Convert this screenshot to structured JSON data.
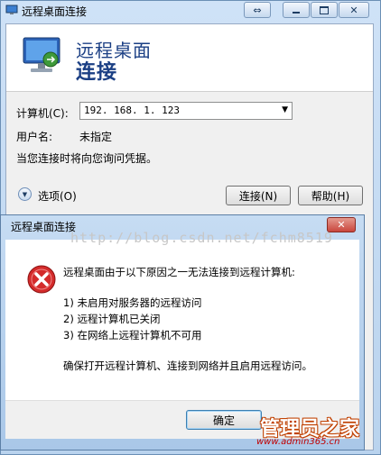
{
  "window": {
    "title": "远程桌面连接",
    "heading_line1": "远程桌面",
    "heading_line2": "连接",
    "computer_label": "计算机(C):",
    "computer_value": "192. 168. 1. 123",
    "username_label": "用户名:",
    "username_value": "未指定",
    "info_text": "当您连接时将向您询问凭据。",
    "options_label": "选项(O)",
    "connect_button": "连接(N)",
    "help_button": "帮助(H)"
  },
  "dialog": {
    "title": "远程桌面连接",
    "message": "远程桌面由于以下原因之一无法连接到远程计算机:",
    "reasons": [
      "1) 未启用对服务器的远程访问",
      "2) 远程计算机已关闭",
      "3) 在网络上远程计算机不可用"
    ],
    "advice": "确保打开远程计算机、连接到网络并且启用远程访问。",
    "ok_button": "确定"
  },
  "watermark": "http://blog.csdn.net/fchm8519",
  "brand": {
    "name": "管理员之家",
    "url": "www.admin365.cn"
  },
  "colors": {
    "heading": "#1b3f84",
    "close": "#c9463d",
    "error_icon": "#d42b2b"
  }
}
